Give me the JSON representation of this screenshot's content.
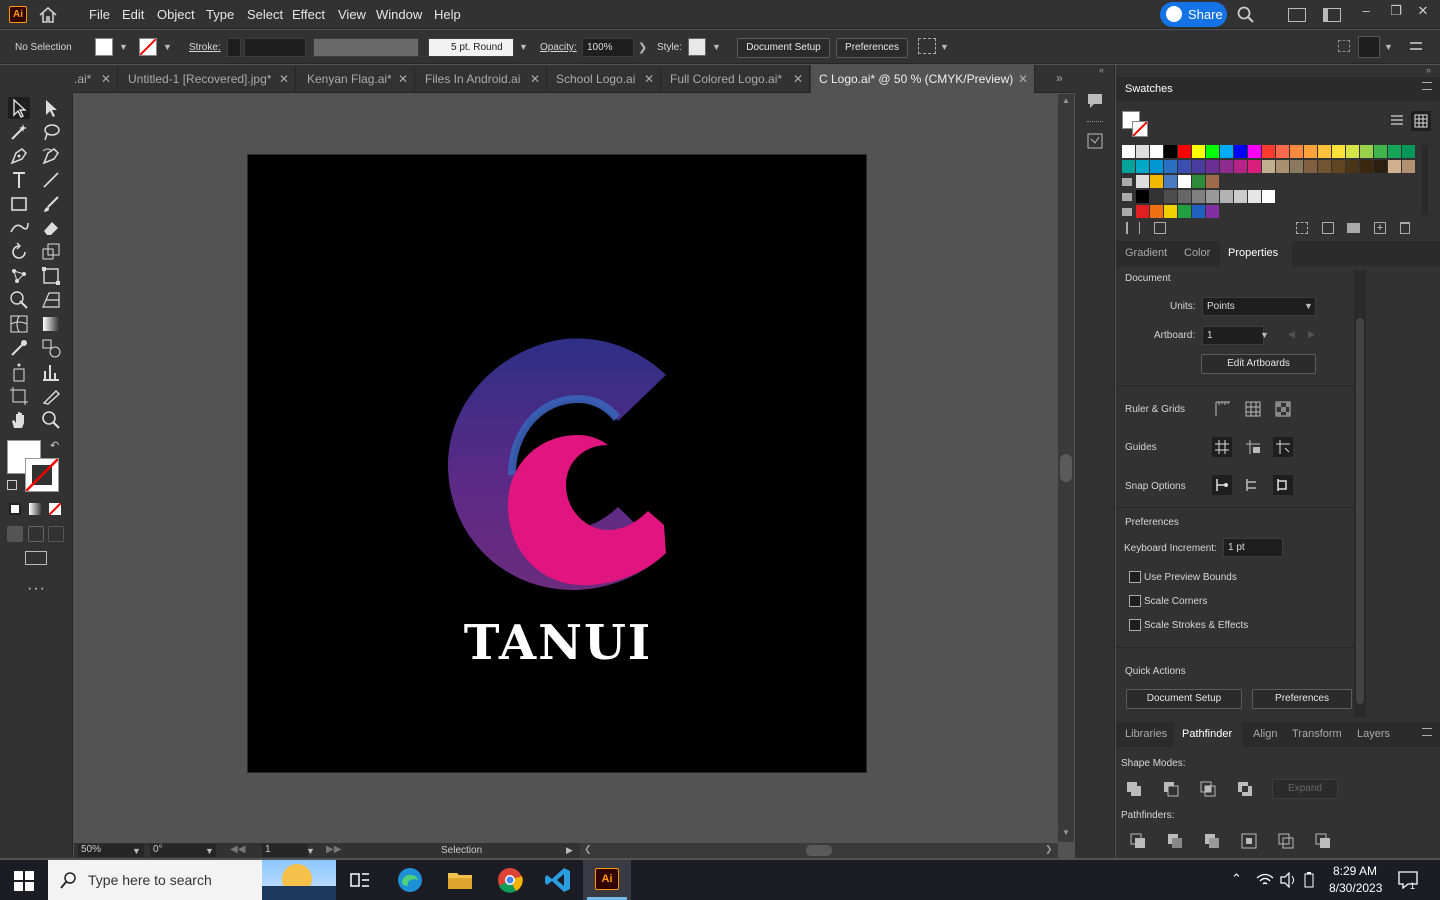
{
  "menubar": {
    "app_badge": "Ai",
    "items": [
      "File",
      "Edit",
      "Object",
      "Type",
      "Select",
      "Effect",
      "View",
      "Window",
      "Help"
    ],
    "share_label": "Share"
  },
  "controlbar": {
    "selection": "No Selection",
    "stroke_label": "Stroke:",
    "brush": "5 pt. Round",
    "opacity_label": "Opacity:",
    "opacity_value": "100%",
    "style_label": "Style:",
    "document_setup": "Document Setup",
    "preferences": "Preferences"
  },
  "tabs": [
    {
      "label": ".ai*"
    },
    {
      "label": "Untitled-1 [Recovered].jpg*"
    },
    {
      "label": "Kenyan Flag.ai*"
    },
    {
      "label": "Files In Android.ai"
    },
    {
      "label": "School Logo.ai"
    },
    {
      "label": "Full Colored Logo.ai*"
    },
    {
      "label": "C Logo.ai* @ 50 % (CMYK/Preview)"
    }
  ],
  "artboard": {
    "logo_text": "TANUI",
    "colors": {
      "top": "#2e2f86",
      "mid": "#6a2a86",
      "bottom": "#e0157f"
    }
  },
  "statusbar": {
    "zoom": "50%",
    "rotation": "0°",
    "artboard_num": "1",
    "tool": "Selection"
  },
  "swatches_panel": {
    "title": "Swatches"
  },
  "properties_panel": {
    "tabs": [
      "Gradient",
      "Color",
      "Properties"
    ],
    "document_label": "Document",
    "units_label": "Units:",
    "units_value": "Points",
    "artboard_label": "Artboard:",
    "artboard_value": "1",
    "edit_artboards": "Edit Artboards",
    "ruler_grids": "Ruler & Grids",
    "guides": "Guides",
    "snap_options": "Snap Options",
    "preferences_label": "Preferences",
    "keyboard_increment_label": "Keyboard Increment:",
    "keyboard_increment_value": "1 pt",
    "checkboxes": [
      "Use Preview Bounds",
      "Scale Corners",
      "Scale Strokes & Effects"
    ],
    "quick_actions": "Quick Actions",
    "qa_document_setup": "Document Setup",
    "qa_preferences": "Preferences"
  },
  "pathfinder_panel": {
    "tabs": [
      "Libraries",
      "Pathfinder",
      "Align",
      "Transform",
      "Layers"
    ],
    "shape_modes": "Shape Modes:",
    "expand": "Expand",
    "pathfinders": "Pathfinders:"
  },
  "taskbar": {
    "search_placeholder": "Type here to search",
    "time": "8:29 AM",
    "date": "8/30/2023",
    "notification_count": "1"
  }
}
